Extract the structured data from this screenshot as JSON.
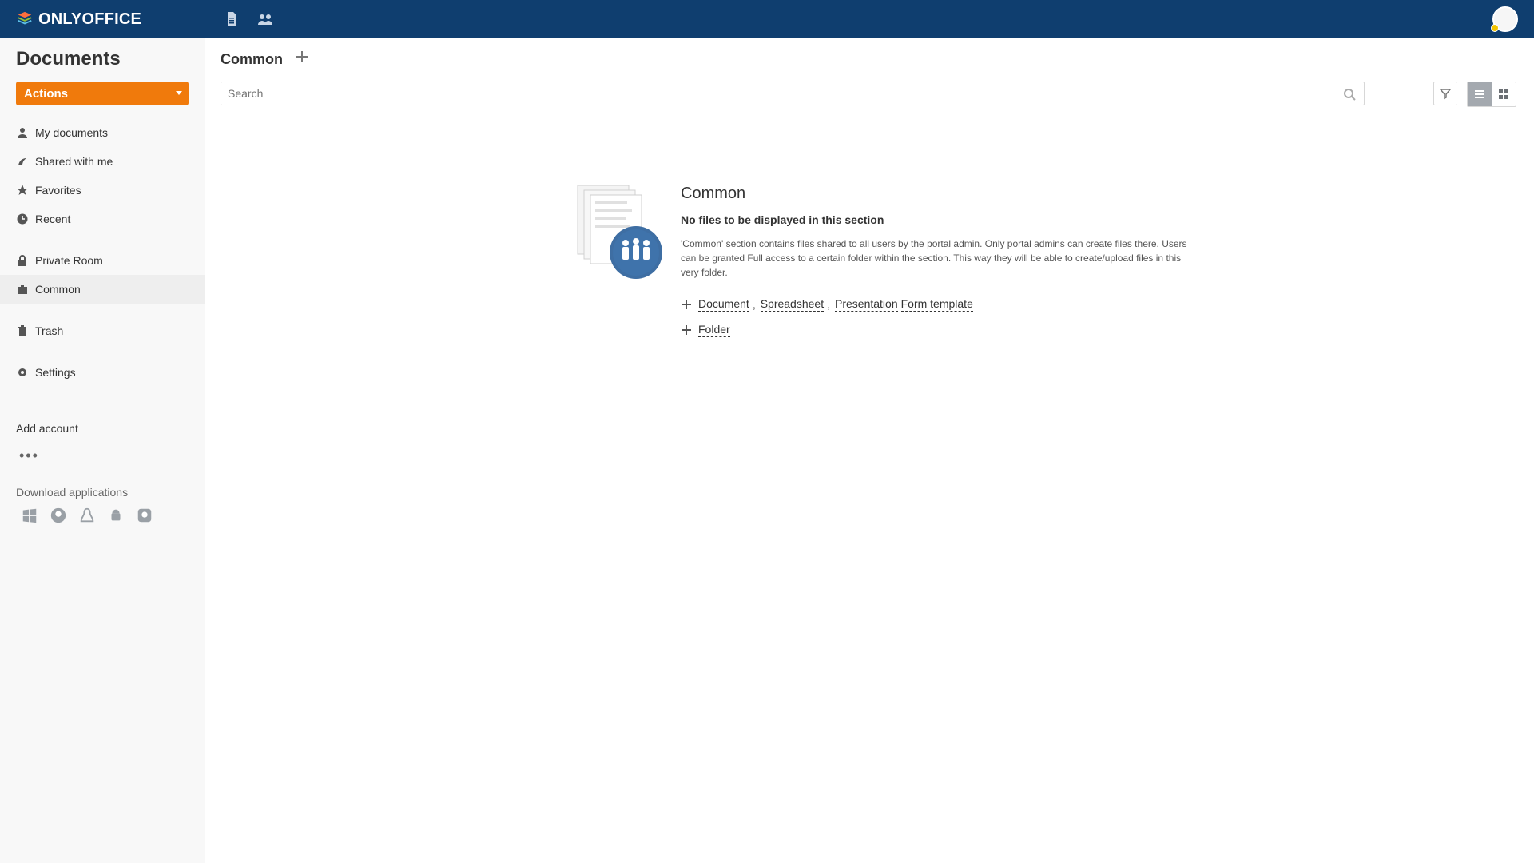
{
  "brand": {
    "name": "ONLYOFFICE"
  },
  "topbar": {
    "icons": [
      "documents-icon",
      "people-icon"
    ]
  },
  "sidebar": {
    "title": "Documents",
    "actions_label": "Actions",
    "items": [
      {
        "label": "My documents",
        "icon": "user-icon"
      },
      {
        "label": "Shared with me",
        "icon": "share-icon"
      },
      {
        "label": "Favorites",
        "icon": "star-icon"
      },
      {
        "label": "Recent",
        "icon": "clock-icon"
      },
      {
        "label": "Private Room",
        "icon": "lock-icon"
      },
      {
        "label": "Common",
        "icon": "briefcase-icon",
        "active": true
      },
      {
        "label": "Trash",
        "icon": "trash-icon"
      },
      {
        "label": "Settings",
        "icon": "gear-icon"
      }
    ],
    "add_account": "Add account",
    "more": "•••",
    "download_label": "Download applications",
    "apps": [
      "windows-icon",
      "mac-icon",
      "linux-icon",
      "android-icon",
      "ios-icon"
    ]
  },
  "main": {
    "title": "Common",
    "search_placeholder": "Search",
    "empty": {
      "title": "Common",
      "subtitle": "No files to be displayed in this section",
      "description": "'Common' section contains files shared to all users by the portal admin. Only portal admins can create files there. Users can be granted Full access to a certain folder within the section. This way they will be able to create/upload files in this very folder.",
      "create_links": [
        "Document",
        "Spreadsheet",
        "Presentation",
        "Form template"
      ],
      "folder_link": "Folder"
    }
  },
  "colors": {
    "topbar": "#0f3e6f",
    "accent": "#f07a0c"
  }
}
